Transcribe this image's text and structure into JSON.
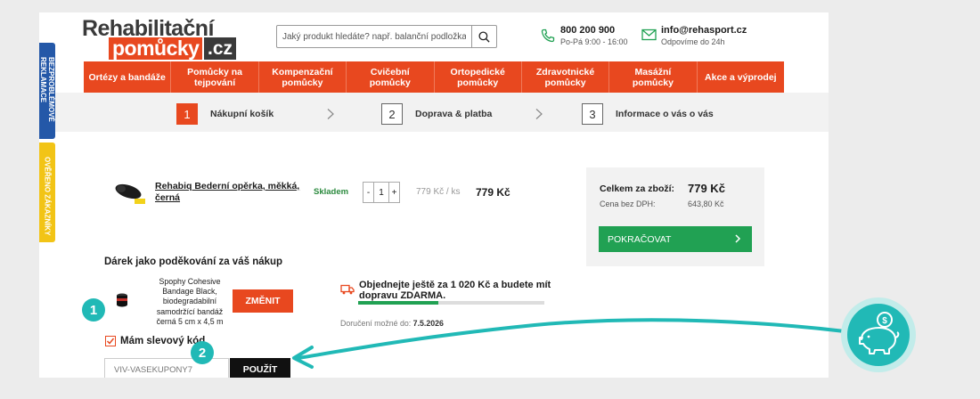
{
  "header": {
    "logo_line1": "Rehabilitační",
    "logo_line2": "pomůcky",
    "logo_tld": ".cz",
    "search_placeholder": "Jaký produkt hledáte? např. balanční podložka...",
    "phone": "800 200 900",
    "phone_hours": "Po-Pá 9:00 - 16:00",
    "email": "info@rehasport.cz",
    "email_note": "Odpovíme do 24h"
  },
  "nav": [
    "Ortézy a bandáže",
    "Pomůcky na tejpování",
    "Kompenzační pomůcky",
    "Cvičební pomůcky",
    "Ortopedické pomůcky",
    "Zdravotnické pomůcky",
    "Masážní pomůcky",
    "Akce a výprodej"
  ],
  "steps": [
    {
      "num": "1",
      "label": "Nákupní košík"
    },
    {
      "num": "2",
      "label": "Doprava & platba"
    },
    {
      "num": "3",
      "label": "Informace o vás o vás"
    }
  ],
  "cart": {
    "product_name": "Rehabiq Bederní opěrka, měkká, černá",
    "stock": "Skladem",
    "qty_minus": "-",
    "qty": "1",
    "qty_plus": "+",
    "unit_price": "779 Kč / ks",
    "price": "779 Kč"
  },
  "summary": {
    "total_label": "Celkem za zboží:",
    "total": "779 Kč",
    "vat_label": "Cena bez DPH:",
    "vat_price": "643,80 Kč",
    "continue_label": "POKRAČOVAT"
  },
  "gift": {
    "title": "Dárek jako poděkování za váš nákup",
    "name": "Spophy Cohesive Bandage Black, biodegradabilní samodržící bandáž černá 5 cm x 4,5 m",
    "change_label": "ZMĚNIT"
  },
  "shipping": {
    "text": "Objednejte ještě za 1 020 Kč a budete mít dopravu ZDARMA.",
    "progress": 0.43,
    "delivery_label": "Doručení možné do:",
    "delivery_date": "7.5.2026"
  },
  "coupon": {
    "label": "Mám slevový kód",
    "checked": true,
    "input_value": "VIV-VASEKUPONY7",
    "apply_label": "POUŽÍT"
  },
  "side_tabs": {
    "blue": "BEZPROBLÉMOVÉ REKLAMACE",
    "yellow": "OVĚŘENO ZÁKAZNÍKY"
  },
  "annotations": {
    "badge1": "1",
    "badge2": "2",
    "pig_icon": "piggy-bank-icon",
    "accent": "#21b9b6"
  },
  "colors": {
    "brand_orange": "#e8481f",
    "cta_green": "#21a153",
    "dark": "#3a3a3a"
  }
}
